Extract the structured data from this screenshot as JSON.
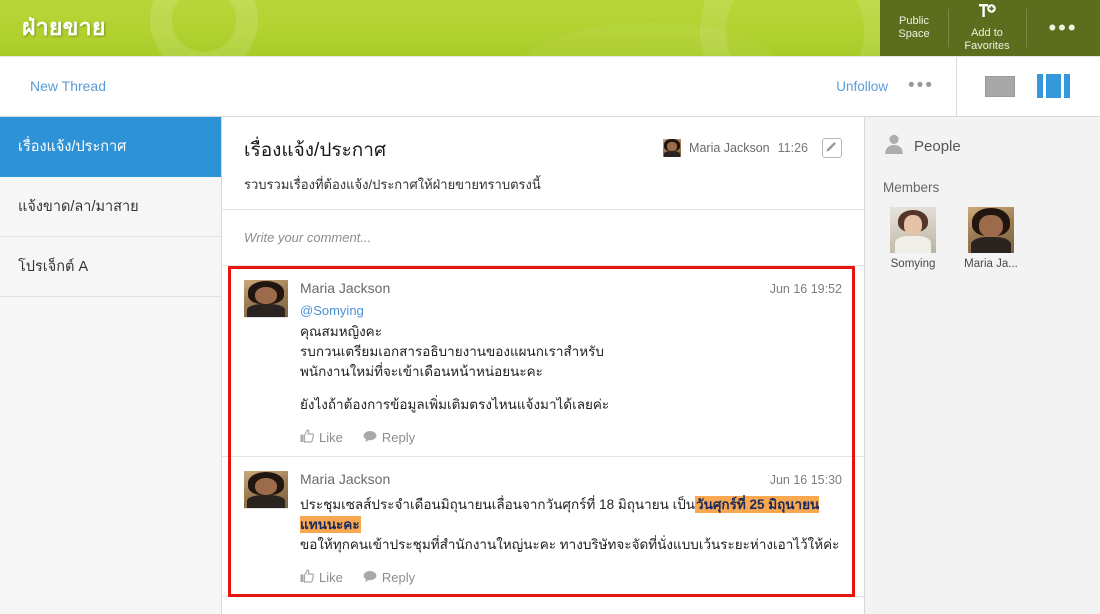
{
  "header": {
    "space_title": "ฝ่ายขาย",
    "public_space_line1": "Public",
    "public_space_line2": "Space",
    "add_fav_line1": "Add to",
    "add_fav_line2": "Favorites",
    "more_glyph": "•••",
    "bg_color": "#b2d231",
    "right_bg_color": "#5d6d1e"
  },
  "toolbar": {
    "new_thread": "New Thread",
    "unfollow": "Unfollow",
    "more_glyph": "•••",
    "accent_color": "#3498db",
    "link_color": "#5b9bd5"
  },
  "sidebar": {
    "items": [
      {
        "label": "เรื่องแจ้ง/ประกาศ",
        "active": true
      },
      {
        "label": "แจ้งขาด/ลา/มาสาย",
        "active": false
      },
      {
        "label": "โปรเจ็กต์ A",
        "active": false
      }
    ],
    "active_color": "#2e92d6"
  },
  "thread": {
    "title": "เรื่องแจ้ง/ประกาศ",
    "author": "Maria Jackson",
    "time": "11:26",
    "description": "รวบรวมเรื่องที่ต้องแจ้ง/ประกาศให้ฝ่ายขายทราบตรงนี้",
    "edit_icon": "pencil-icon"
  },
  "comment": {
    "placeholder": "Write your comment..."
  },
  "posts": [
    {
      "author": "Maria Jackson",
      "date": "Jun 16 19:52",
      "mention": "@Somying",
      "lines": [
        "คุณสมหญิงคะ",
        "รบกวนเตรียมเอกสารอธิบายงานของแผนกเราสำหรับ",
        "พนักงานใหม่ที่จะเข้าเดือนหน้าหน่อยนะคะ"
      ],
      "line_after_blank": "ยังไงถ้าต้องการข้อมูลเพิ่มเติมตรงไหนแจ้งมาได้เลยค่ะ",
      "like_label": "Like",
      "reply_label": "Reply"
    },
    {
      "author": "Maria Jackson",
      "date": "Jun 16 15:30",
      "text_before_highlight": "ประชุมเซลส์ประจำเดือนมิถุนายนเลื่อนจากวันศุกร์ที่ 18 มิถุนายน เป็น",
      "highlight_text": "วันศุกร์ที่ 25 มิถุนายนแทนนะคะ",
      "highlight_color": "#f7a851",
      "text_line2": "ขอให้ทุกคนเข้าประชุมที่สำนักงานใหญ่นะคะ ทางบริษัทจะจัดที่นั่งแบบเว้นระยะห่างเอาไว้ให้ค่ะ",
      "like_label": "Like",
      "reply_label": "Reply"
    }
  ],
  "right_panel": {
    "people_label": "People",
    "members_label": "Members",
    "members": [
      {
        "name": "Somying"
      },
      {
        "name": "Maria Ja..."
      }
    ]
  },
  "annotation": {
    "frame_color": "#e8150f"
  }
}
